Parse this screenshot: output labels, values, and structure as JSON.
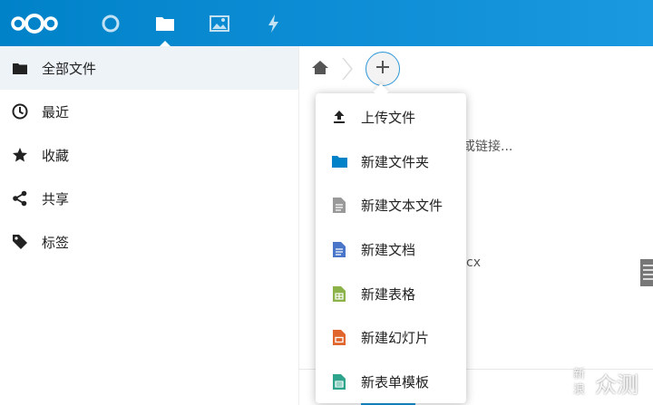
{
  "topbar": {
    "logo_icon": "nextcloud-logo-icon",
    "apps": [
      {
        "icon": "activity-circle-icon"
      },
      {
        "icon": "files-folder-icon",
        "active": true
      },
      {
        "icon": "gallery-image-icon"
      },
      {
        "icon": "activity-lightning-icon"
      }
    ],
    "color": "#0082c9"
  },
  "sidebar": {
    "items": [
      {
        "label": "全部文件",
        "icon": "folder-icon"
      },
      {
        "label": "最近",
        "icon": "clock-icon"
      },
      {
        "label": "收藏",
        "icon": "star-icon"
      },
      {
        "label": "共享",
        "icon": "share-icon"
      },
      {
        "label": "标签",
        "icon": "tag-icon"
      }
    ]
  },
  "breadcrumb": {
    "home_icon": "home-icon",
    "add_icon": "plus-icon"
  },
  "background": {
    "text1": "或链接...",
    "text2": "cx"
  },
  "new_menu": {
    "items": [
      {
        "label": "上传文件",
        "icon": "upload-icon",
        "color": "#222222"
      },
      {
        "label": "新建文件夹",
        "icon": "folder-icon",
        "color": "#0082c9"
      },
      {
        "label": "新建文本文件",
        "icon": "text-file-icon",
        "color": "#999999"
      },
      {
        "label": "新建文档",
        "icon": "document-icon",
        "color": "#4a76c9"
      },
      {
        "label": "新建表格",
        "icon": "spreadsheet-icon",
        "color": "#8bb34a"
      },
      {
        "label": "新建幻灯片",
        "icon": "presentation-icon",
        "color": "#e0662e"
      },
      {
        "label": "新表单模板",
        "icon": "form-template-icon",
        "color": "#2ea48c"
      }
    ]
  },
  "watermark": {
    "text1": "新",
    "text2": "浪",
    "text3": "众测"
  }
}
